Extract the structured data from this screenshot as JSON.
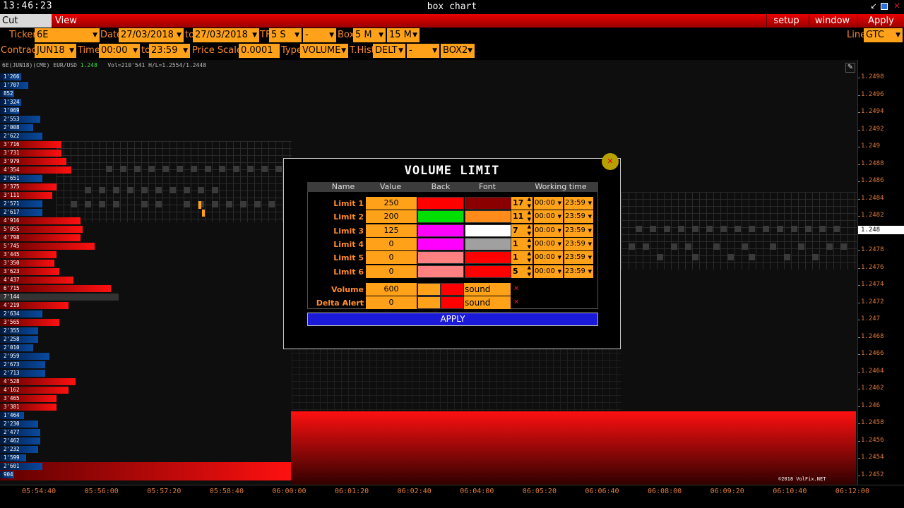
{
  "titlebar": {
    "clock": "13:46:23",
    "title": "box chart",
    "icons": [
      "restore-icon",
      "maximize-icon",
      "close-icon"
    ]
  },
  "menubar": {
    "tabs": [
      "Cut Breaks",
      "View DOM"
    ],
    "right": [
      "setup",
      "window",
      "Apply"
    ]
  },
  "controls": {
    "ticker_label": "Ticker",
    "ticker": "6E",
    "date_label": "Date",
    "date_from": "27/03/2018",
    "to_label": "to",
    "date_to": "27/03/2018",
    "tf_label": "TF",
    "tf": "5 S",
    "tf2": "-",
    "box_label": "Box",
    "box": "5 M",
    "box2": "15 M",
    "line_label": "Line",
    "line": "GTC",
    "contract_label": "Contract",
    "contract": "JUN18",
    "time_label": "Time",
    "time_from": "00:00",
    "time_to_label": "to",
    "time_to": "23:59",
    "price_scale_label": "Price Scale",
    "price_scale": "0.0001",
    "type_label": "Type",
    "type": "VOLUME",
    "thist_label": "T.Hist",
    "thist": "DELT",
    "thist2": "-",
    "box2_sel": "BOX2"
  },
  "chart": {
    "info_prefix": "6E(JUN18)(CME) EUR/USD",
    "info_price": "1.248",
    "info_suffix": "Vol=210'541 H/L=1.2554/1.2448",
    "copyright": "©2018 VolFix.NET",
    "current_price": "1.248",
    "price_ticks": [
      "1.2498",
      "1.2496",
      "1.2494",
      "1.2492",
      "1.249",
      "1.2488",
      "1.2486",
      "1.2484",
      "1.2482",
      "1.248",
      "1.2478",
      "1.2476",
      "1.2474",
      "1.2472",
      "1.247",
      "1.2468",
      "1.2466",
      "1.2464",
      "1.2462",
      "1.246",
      "1.2458",
      "1.2456",
      "1.2454",
      "1.2452"
    ],
    "time_ticks": [
      "05:54:40",
      "05:56:00",
      "05:57:20",
      "05:58:40",
      "06:00:00",
      "06:01:20",
      "06:02:40",
      "06:04:00",
      "06:05:20",
      "06:06:40",
      "06:08:00",
      "06:09:20",
      "06:10:40",
      "06:12:00"
    ],
    "volume_profile": [
      {
        "v": "1'266",
        "c": "blue",
        "w": 0.09
      },
      {
        "v": "1'707",
        "c": "blue",
        "w": 0.12
      },
      {
        "v": "852",
        "c": "blue",
        "w": 0.06
      },
      {
        "v": "1'324",
        "c": "blue",
        "w": 0.09
      },
      {
        "v": "1'069",
        "c": "blue",
        "w": 0.08
      },
      {
        "v": "2'553",
        "c": "blue",
        "w": 0.17
      },
      {
        "v": "2'008",
        "c": "blue",
        "w": 0.14
      },
      {
        "v": "2'622",
        "c": "blue",
        "w": 0.18
      },
      {
        "v": "3'716",
        "c": "red",
        "w": 0.26
      },
      {
        "v": "3'731",
        "c": "red",
        "w": 0.26
      },
      {
        "v": "3'979",
        "c": "red",
        "w": 0.28
      },
      {
        "v": "4'354",
        "c": "red",
        "w": 0.3
      },
      {
        "v": "2'651",
        "c": "blue",
        "w": 0.18
      },
      {
        "v": "3'375",
        "c": "red",
        "w": 0.24
      },
      {
        "v": "3'111",
        "c": "red",
        "w": 0.22
      },
      {
        "v": "2'571",
        "c": "blue",
        "w": 0.18
      },
      {
        "v": "2'617",
        "c": "blue",
        "w": 0.18
      },
      {
        "v": "4'916",
        "c": "red",
        "w": 0.34
      },
      {
        "v": "5'055",
        "c": "red",
        "w": 0.35
      },
      {
        "v": "4'798",
        "c": "red",
        "w": 0.34
      },
      {
        "v": "5'745",
        "c": "red",
        "w": 0.4
      },
      {
        "v": "3'445",
        "c": "red",
        "w": 0.24
      },
      {
        "v": "3'350",
        "c": "red",
        "w": 0.23
      },
      {
        "v": "3'623",
        "c": "red",
        "w": 0.25
      },
      {
        "v": "4'437",
        "c": "red",
        "w": 0.31
      },
      {
        "v": "6'715",
        "c": "red",
        "w": 0.47
      },
      {
        "v": "7'144",
        "c": "grey",
        "w": 0.5
      },
      {
        "v": "4'219",
        "c": "red",
        "w": 0.29
      },
      {
        "v": "2'634",
        "c": "blue",
        "w": 0.18
      },
      {
        "v": "3'565",
        "c": "red",
        "w": 0.25
      },
      {
        "v": "2'355",
        "c": "blue",
        "w": 0.16
      },
      {
        "v": "2'258",
        "c": "blue",
        "w": 0.16
      },
      {
        "v": "2'010",
        "c": "blue",
        "w": 0.14
      },
      {
        "v": "2'959",
        "c": "blue",
        "w": 0.21
      },
      {
        "v": "2'673",
        "c": "blue",
        "w": 0.19
      },
      {
        "v": "2'713",
        "c": "blue",
        "w": 0.19
      },
      {
        "v": "4'528",
        "c": "red",
        "w": 0.32
      },
      {
        "v": "4'162",
        "c": "red",
        "w": 0.29
      },
      {
        "v": "3'465",
        "c": "red",
        "w": 0.24
      },
      {
        "v": "3'381",
        "c": "red",
        "w": 0.24
      },
      {
        "v": "1'464",
        "c": "blue",
        "w": 0.1
      },
      {
        "v": "2'230",
        "c": "blue",
        "w": 0.16
      },
      {
        "v": "2'477",
        "c": "blue",
        "w": 0.17
      },
      {
        "v": "2'462",
        "c": "blue",
        "w": 0.17
      },
      {
        "v": "2'232",
        "c": "blue",
        "w": 0.16
      },
      {
        "v": "1'599",
        "c": "blue",
        "w": 0.11
      },
      {
        "v": "2'601",
        "c": "blue",
        "w": 0.18
      },
      {
        "v": "904",
        "c": "blue",
        "w": 0.06
      }
    ]
  },
  "dialog": {
    "title": "VOLUME LIMIT",
    "headers": [
      "Name",
      "Value",
      "Back",
      "Font",
      "Working time"
    ],
    "limits": [
      {
        "name": "Limit 1",
        "value": "250",
        "back": "#ff0000",
        "font": "#8a0000",
        "num": "17",
        "from": "00:00",
        "to": "23:59"
      },
      {
        "name": "Limit 2",
        "value": "200",
        "back": "#00e000",
        "font": "#ff8c1a",
        "num": "11",
        "from": "00:00",
        "to": "23:59"
      },
      {
        "name": "Limit 3",
        "value": "125",
        "back": "#ff00ff",
        "font": "#ffffff",
        "num": "7",
        "from": "00:00",
        "to": "23:59"
      },
      {
        "name": "Limit 4",
        "value": "0",
        "back": "#ff00ff",
        "font": "#a0a0a0",
        "num": "1",
        "from": "00:00",
        "to": "23:59"
      },
      {
        "name": "Limit 5",
        "value": "0",
        "back": "#ff8080",
        "font": "#ff0000",
        "num": "1",
        "from": "00:00",
        "to": "23:59"
      },
      {
        "name": "Limit 6",
        "value": "0",
        "back": "#ff8080",
        "font": "#ff0000",
        "num": "5",
        "from": "00:00",
        "to": "23:59"
      }
    ],
    "alerts": [
      {
        "name": "Volume Alert",
        "value": "600",
        "sound": "sound"
      },
      {
        "name": "Delta Alert",
        "value": "0",
        "sound": "sound"
      }
    ],
    "apply": "APPLY"
  }
}
